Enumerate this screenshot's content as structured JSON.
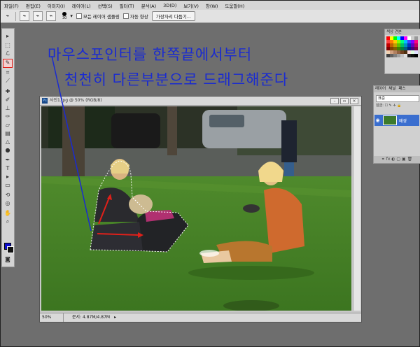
{
  "menu": [
    "파일(F)",
    "편집(E)",
    "이미지(I)",
    "레이어(L)",
    "선택(S)",
    "필터(T)",
    "분석(A)",
    "3D(D)",
    "보기(V)",
    "창(W)",
    "도움말(H)"
  ],
  "options": {
    "brush_size": "30",
    "sample_all_layers": "모든 레이어 샘플링",
    "auto_enhance": "자동 향상",
    "refine_edge_button": "가장자리 다듬기..."
  },
  "swatch_panel": {
    "tab_label": "색상 견본"
  },
  "swatch_colors": [
    "#ff0000",
    "#ffff00",
    "#00ff00",
    "#00ffff",
    "#0000ff",
    "#ff00ff",
    "#ffffff",
    "#cccccc",
    "#999999",
    "#ff4040",
    "#ff8000",
    "#ffcc00",
    "#80ff00",
    "#00ff80",
    "#00c0ff",
    "#4040ff",
    "#8000ff",
    "#ff0080",
    "#c00000",
    "#c06000",
    "#c0a000",
    "#60c000",
    "#00c060",
    "#0090c0",
    "#0030c0",
    "#6000c0",
    "#c00060",
    "#800000",
    "#804000",
    "#806000",
    "#408000",
    "#008040",
    "#006080",
    "#002080",
    "#400080",
    "#800040",
    "#f0d0b0",
    "#d0a080",
    "#b08060",
    "#906040",
    "#704020",
    "#503010",
    "#ffe0e0",
    "#e0ffe0",
    "#e0e0ff",
    "#404040",
    "#606060",
    "#808080",
    "#a0a0a0",
    "#c0c0c0",
    "#e0e0e0",
    "#202020",
    "#101010",
    "#000000"
  ],
  "layers_panel": {
    "tabs": [
      "레이어",
      "채널",
      "패스"
    ],
    "blend_mode": "표준",
    "lock_label": "잠금:",
    "layer_name": "배경"
  },
  "document": {
    "title": "사진1.jpg @ 50% (RGB/8)",
    "zoom": "50%",
    "doc_info": "문서: 4.87M/4.87M"
  },
  "annotation": {
    "line1": "마우스포인터를 한쪽끝에서부터",
    "line2": "천천히 다른부분으로 드래그해준다"
  },
  "colors": {
    "annotation_text": "#1a2bd0",
    "foreground": "#0a0acc",
    "background": "#111111",
    "selected_tool_border": "#e0201a"
  }
}
